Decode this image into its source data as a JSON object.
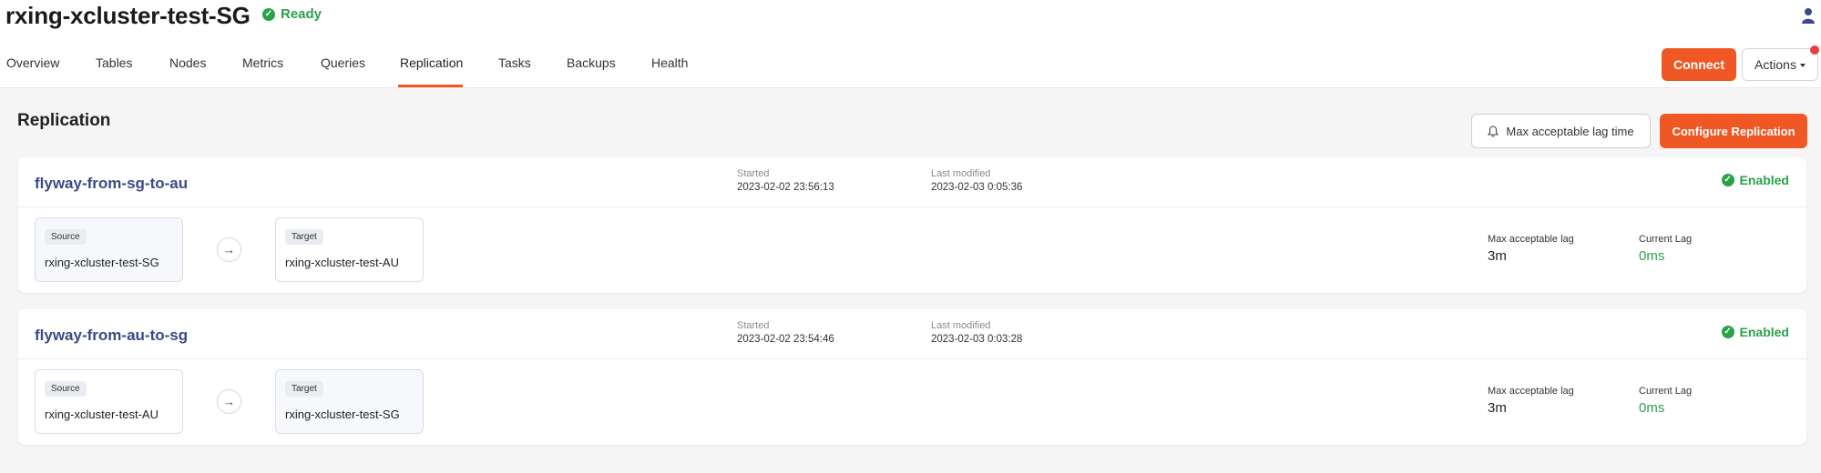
{
  "header": {
    "cluster_name": "rxing-xcluster-test-SG",
    "status": "Ready"
  },
  "tabs": [
    {
      "label": "Overview"
    },
    {
      "label": "Tables"
    },
    {
      "label": "Nodes"
    },
    {
      "label": "Metrics"
    },
    {
      "label": "Queries"
    },
    {
      "label": "Replication",
      "active": true
    },
    {
      "label": "Tasks"
    },
    {
      "label": "Backups"
    },
    {
      "label": "Health"
    }
  ],
  "actions": {
    "connect_label": "Connect",
    "actions_label": "Actions"
  },
  "page": {
    "title": "Replication",
    "max_lag_button": "Max acceptable lag time",
    "configure_button": "Configure Replication"
  },
  "replications": [
    {
      "name": "flyway-from-sg-to-au",
      "started_label": "Started",
      "started": "2023-02-02 23:56:13",
      "modified_label": "Last modified",
      "modified": "2023-02-03 0:05:36",
      "status": "Enabled",
      "source_tag": "Source",
      "source": "rxing-xcluster-test-SG",
      "target_tag": "Target",
      "target": "rxing-xcluster-test-AU",
      "max_lag_label": "Max acceptable lag",
      "max_lag": "3m",
      "current_lag_label": "Current Lag",
      "current_lag": "0ms"
    },
    {
      "name": "flyway-from-au-to-sg",
      "started_label": "Started",
      "started": "2023-02-02 23:54:46",
      "modified_label": "Last modified",
      "modified": "2023-02-03 0:03:28",
      "status": "Enabled",
      "source_tag": "Source",
      "source": "rxing-xcluster-test-AU",
      "target_tag": "Target",
      "target": "rxing-xcluster-test-SG",
      "max_lag_label": "Max acceptable lag",
      "max_lag": "3m",
      "current_lag_label": "Current Lag",
      "current_lag": "0ms"
    }
  ],
  "icons": {
    "check": "check-circle-icon",
    "bell": "bell-icon",
    "arrow": "arrow-right-icon",
    "user": "user-icon"
  },
  "colors": {
    "accent": "#ef5824",
    "success": "#2ba14a",
    "link": "#3b4a86"
  }
}
